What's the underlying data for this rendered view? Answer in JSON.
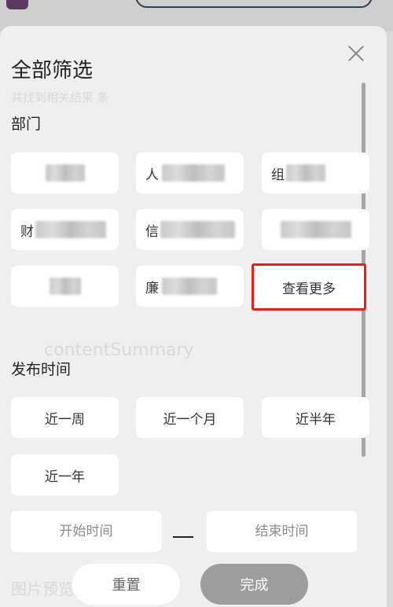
{
  "header": {
    "title": "全部筛选",
    "close_label": "×"
  },
  "department": {
    "label": "部门",
    "chips": [
      {
        "text": ""
      },
      {
        "text": "人"
      },
      {
        "text": "组"
      },
      {
        "text": "财"
      },
      {
        "text": "信"
      },
      {
        "text": ""
      },
      {
        "text": ""
      },
      {
        "text": "廉"
      }
    ],
    "more_label": "查看更多"
  },
  "publish_time": {
    "label": "发布时间",
    "options": [
      "近一周",
      "近一个月",
      "近半年",
      "近一年"
    ],
    "start_placeholder": "开始时间",
    "end_placeholder": "结束时间"
  },
  "footer": {
    "reset_label": "重置",
    "done_label": "完成"
  },
  "background": {
    "ghost_texts": [
      "共找到相关结果 条",
      "contentSummary",
      "图片预览"
    ]
  },
  "colors": {
    "highlight_border": "#e3201c",
    "done_button": "#9d9d9d"
  }
}
